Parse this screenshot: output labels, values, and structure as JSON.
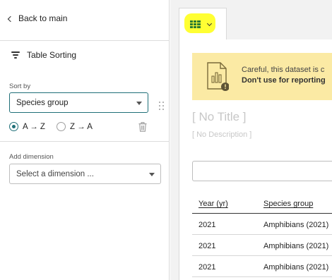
{
  "sidebar": {
    "back_label": "Back to main",
    "section_title": "Table Sorting",
    "sort_by_label": "Sort by",
    "sort_by_value": "Species group",
    "order_asc_label": "A → Z",
    "order_desc_label": "Z → A",
    "order_selected": "asc",
    "add_dimension_label": "Add dimension",
    "add_dimension_placeholder": "Select a dimension ..."
  },
  "main": {
    "tab_icon": "table-icon",
    "warning": {
      "line1": "Careful, this dataset is c",
      "line2": "Don't use for reporting"
    },
    "title_placeholder": "[ No Title ]",
    "description_placeholder": "[ No Description ]",
    "search_value": "",
    "table": {
      "headers": [
        "Year (yr)",
        "Species group"
      ],
      "rows": [
        [
          "2021",
          "Amphibians (2021)"
        ],
        [
          "2021",
          "Amphibians (2021)"
        ],
        [
          "2021",
          "Amphibians (2021)"
        ]
      ]
    }
  },
  "colors": {
    "accent": "#1f6f78",
    "highlight": "#ffff33",
    "warning_bg": "#fbeaa4",
    "table_icon": "#2e7d32"
  }
}
